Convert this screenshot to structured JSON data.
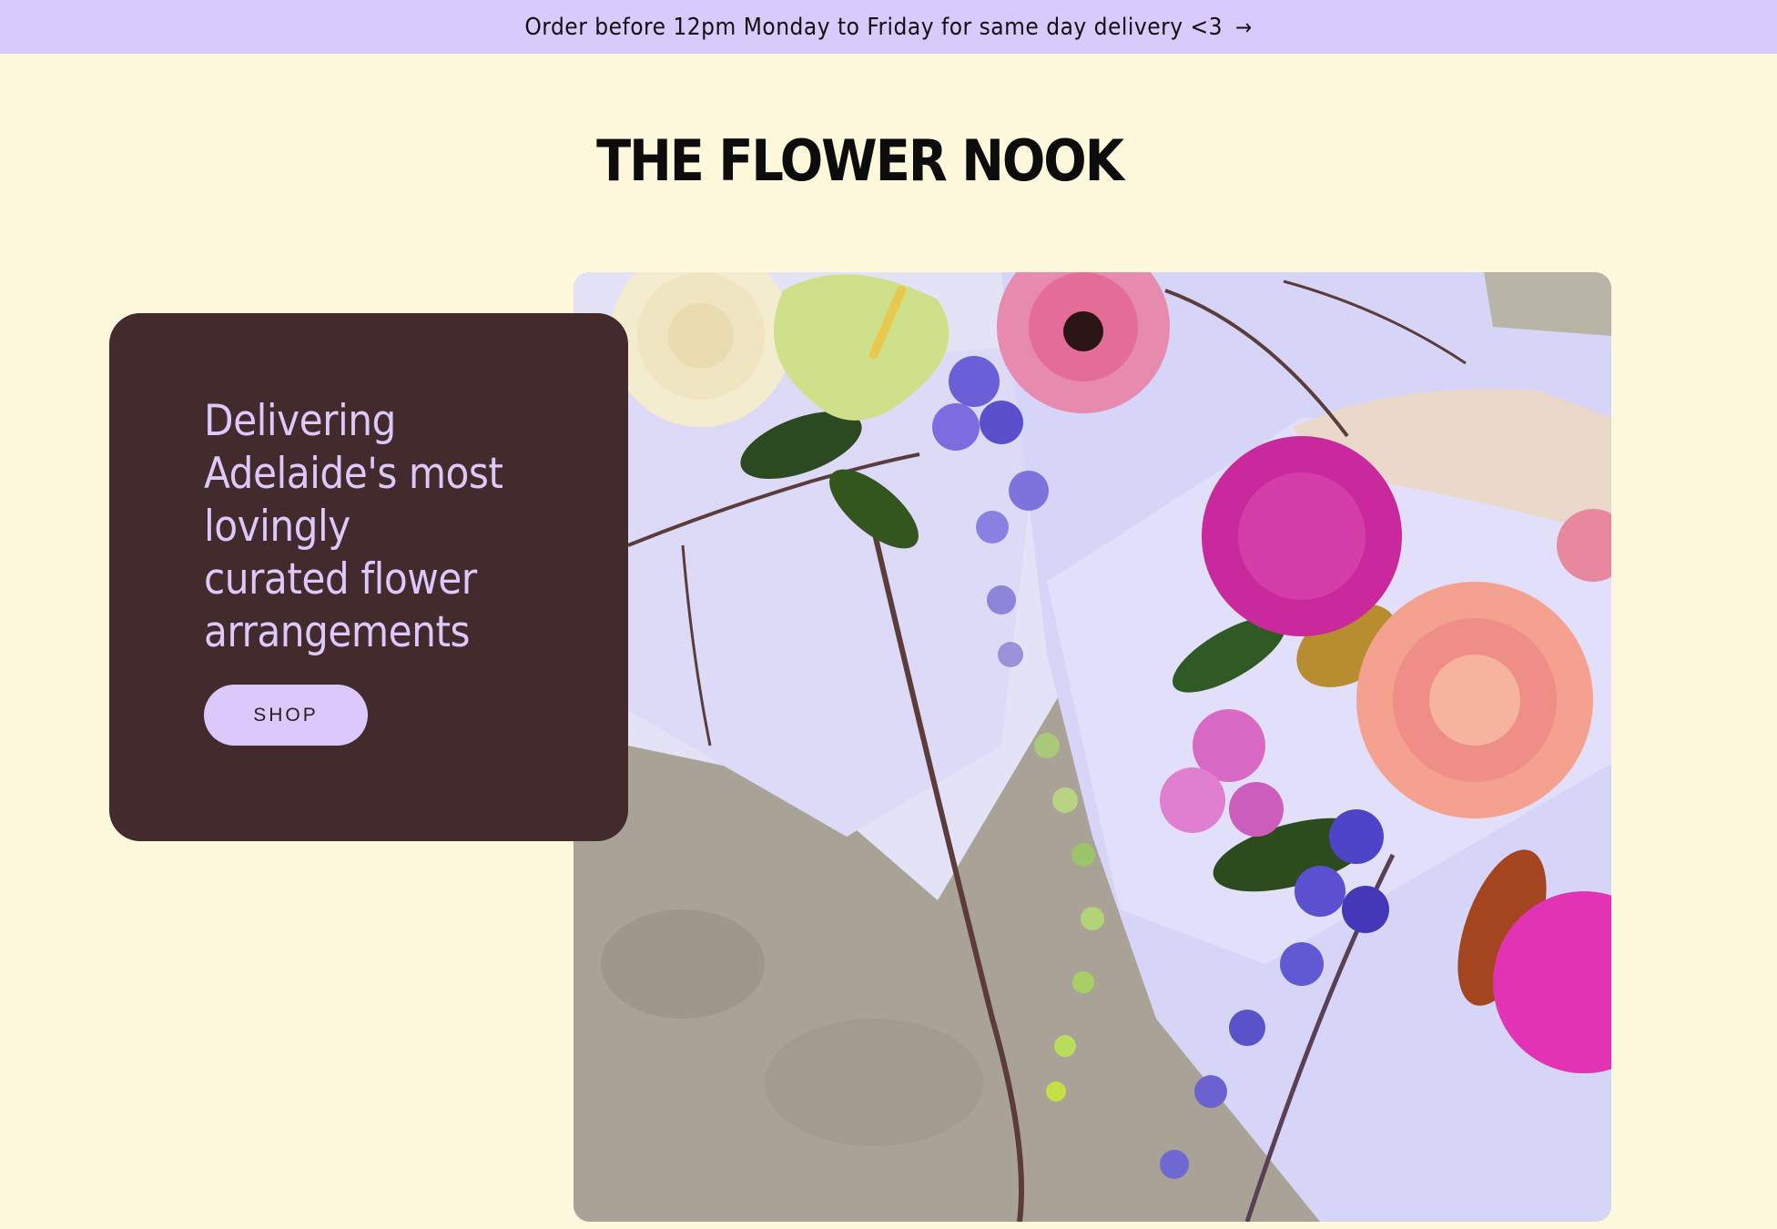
{
  "announcement": {
    "text": "Order before 12pm Monday to Friday for same day delivery <3",
    "arrow": "→"
  },
  "header": {
    "logo_text": "THE FLOWER NOOK"
  },
  "hero": {
    "heading": "Delivering Adelaide's most lovingly curated flower arrangements",
    "button_label": "SHOP"
  },
  "colors": {
    "page_background": "#fef8dc",
    "announcement_background": "#d9cafc",
    "card_background": "#432a2c",
    "accent_lilac": "#dcc8fb"
  }
}
